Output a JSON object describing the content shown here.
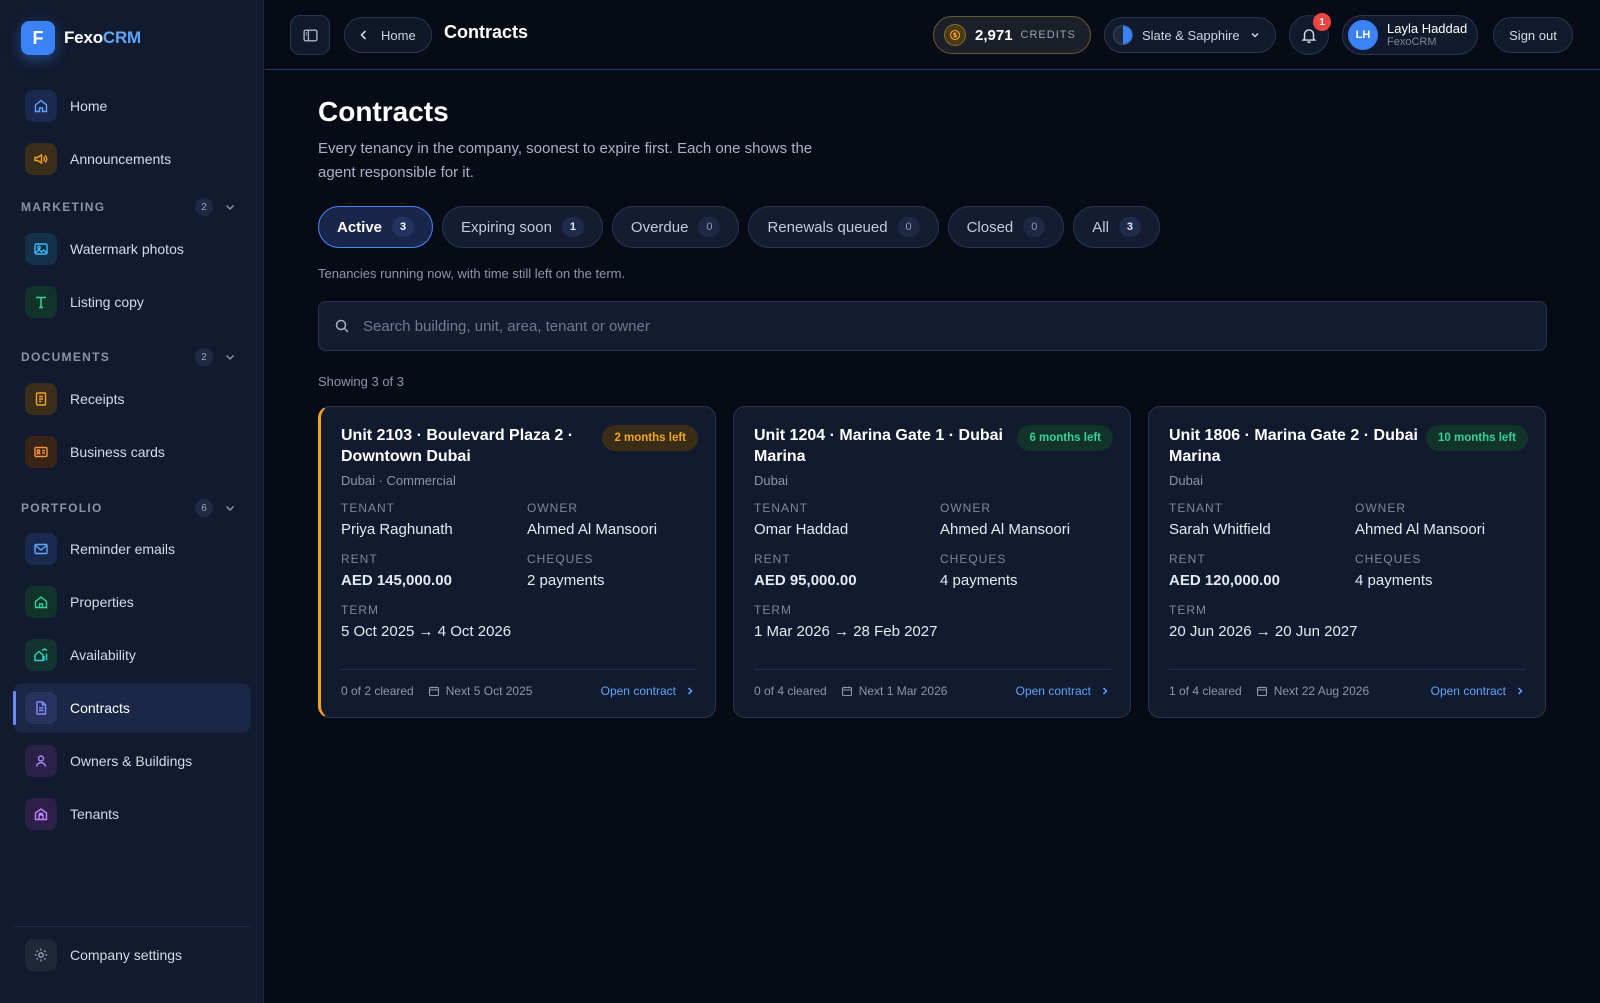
{
  "brand": {
    "initial": "F",
    "name_main": "Fexo",
    "name_accent": "CRM"
  },
  "sidebar": {
    "top_items": [
      {
        "label": "Home",
        "icon": "home-icon"
      },
      {
        "label": "Announcements",
        "icon": "megaphone-icon"
      }
    ],
    "sections": [
      {
        "title": "MARKETING",
        "count": "2",
        "items": [
          {
            "label": "Watermark photos",
            "icon": "image-icon"
          },
          {
            "label": "Listing copy",
            "icon": "text-icon"
          }
        ]
      },
      {
        "title": "DOCUMENTS",
        "count": "2",
        "items": [
          {
            "label": "Receipts",
            "icon": "receipt-icon"
          },
          {
            "label": "Business cards",
            "icon": "id-card-icon"
          }
        ]
      },
      {
        "title": "PORTFOLIO",
        "count": "6",
        "items": [
          {
            "label": "Reminder emails",
            "icon": "mail-icon"
          },
          {
            "label": "Properties",
            "icon": "house-icon"
          },
          {
            "label": "Availability",
            "icon": "chart-house-icon"
          },
          {
            "label": "Contracts",
            "icon": "document-icon"
          },
          {
            "label": "Owners & Buildings",
            "icon": "person-icon"
          },
          {
            "label": "Tenants",
            "icon": "building-icon"
          }
        ]
      }
    ],
    "footer_item": {
      "label": "Company settings",
      "icon": "gear-icon"
    }
  },
  "topbar": {
    "back_label": "Home",
    "title": "Contracts",
    "credits_value": "2,971",
    "credits_label": "CREDITS",
    "theme_label": "Slate & Sapphire",
    "notifications_count": "1",
    "user_initials": "LH",
    "user_name": "Layla Haddad",
    "user_org": "FexoCRM",
    "signout_label": "Sign out"
  },
  "page": {
    "title": "Contracts",
    "description": "Every tenancy in the company, soonest to expire first. Each one shows the agent responsible for it.",
    "tab_hint": "Tenancies running now, with time still left on the term.",
    "search_placeholder": "Search building, unit, area, tenant or owner",
    "showing": "Showing 3 of 3"
  },
  "tabs": [
    {
      "label": "Active",
      "count": "3"
    },
    {
      "label": "Expiring soon",
      "count": "1"
    },
    {
      "label": "Overdue",
      "count": "0"
    },
    {
      "label": "Renewals queued",
      "count": "0"
    },
    {
      "label": "Closed",
      "count": "0"
    },
    {
      "label": "All",
      "count": "3"
    }
  ],
  "labels": {
    "tenant": "TENANT",
    "owner": "OWNER",
    "rent": "RENT",
    "cheques": "CHEQUES",
    "term": "TERM",
    "open_contract": "Open contract"
  },
  "contracts": [
    {
      "title": "Unit 2103 · Boulevard Plaza 2 · Downtown Dubai",
      "subtitle": "Dubai · Commercial",
      "badge": "2 months left",
      "badge_color": "#f5a524",
      "tenant": "Priya Raghunath",
      "owner": "Ahmed Al Mansoori",
      "rent": "AED 145,000.00",
      "cheques": "2 payments",
      "term": "5 Oct 2025 → 4 Oct 2026",
      "cleared": "0 of 2 cleared",
      "next": "Next 5 Oct 2025"
    },
    {
      "title": "Unit 1204 · Marina Gate 1 · Dubai Marina",
      "subtitle": "Dubai",
      "badge": "6 months left",
      "badge_color": "#34d399",
      "tenant": "Omar Haddad",
      "owner": "Ahmed Al Mansoori",
      "rent": "AED 95,000.00",
      "cheques": "4 payments",
      "term": "1 Mar 2026 → 28 Feb 2027",
      "cleared": "0 of 4 cleared",
      "next": "Next 1 Mar 2026"
    },
    {
      "title": "Unit 1806 · Marina Gate 2 · Dubai Marina",
      "subtitle": "Dubai",
      "badge": "10 months left",
      "badge_color": "#34d399",
      "tenant": "Sarah Whitfield",
      "owner": "Ahmed Al Mansoori",
      "rent": "AED 120,000.00",
      "cheques": "4 payments",
      "term": "20 Jun 2026 → 20 Jun 2027",
      "cleared": "1 of 4 cleared",
      "next": "Next 22 Aug 2026"
    }
  ],
  "colors": {
    "accent": "#3b82f6",
    "warning": "#f5a524",
    "success": "#34d399",
    "danger": "#ef4444"
  }
}
